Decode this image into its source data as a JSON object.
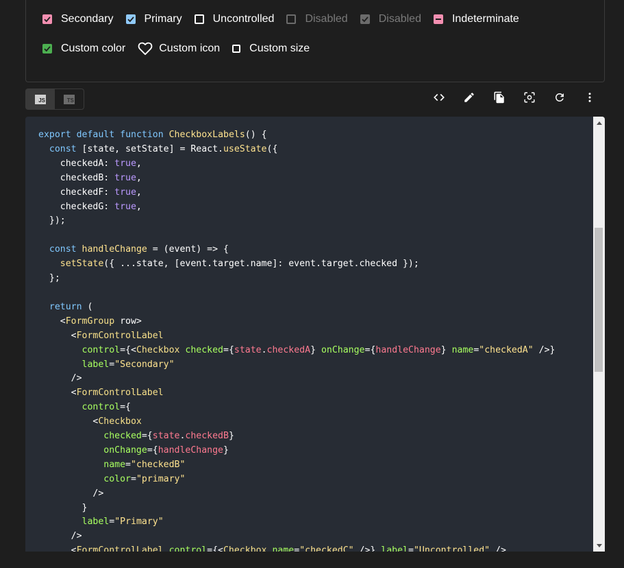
{
  "demo": {
    "row1": [
      {
        "label": "Secondary",
        "state": "checked",
        "color": "#f48fb1"
      },
      {
        "label": "Primary",
        "state": "checked",
        "color": "#90caf9"
      },
      {
        "label": "Uncontrolled",
        "state": "unchecked"
      },
      {
        "label": "Disabled",
        "state": "disabled-unchecked"
      },
      {
        "label": "Disabled",
        "state": "disabled-checked"
      },
      {
        "label": "Indeterminate",
        "state": "indeterminate",
        "color": "#f48fb1"
      }
    ],
    "row2": [
      {
        "label": "Custom color",
        "state": "checked",
        "color": "#4caf50"
      },
      {
        "label": "Custom icon",
        "icon": "heart-outline-icon"
      },
      {
        "label": "Custom size",
        "state": "unchecked-small"
      }
    ]
  },
  "toolbar": {
    "languages": [
      {
        "label": "JS",
        "active": true
      },
      {
        "label": "TS",
        "active": false
      }
    ],
    "actions": [
      "code-icon",
      "edit-icon",
      "copy-icon",
      "screenshot-icon",
      "reset-icon",
      "more-vert-icon"
    ]
  },
  "code": {
    "language": "javascript",
    "lines": [
      "export default function CheckboxLabels() {",
      "  const [state, setState] = React.useState({",
      "    checkedA: true,",
      "    checkedB: true,",
      "    checkedF: true,",
      "    checkedG: true,",
      "  });",
      "",
      "  const handleChange = (event) => {",
      "    setState({ ...state, [event.target.name]: event.target.checked });",
      "  };",
      "",
      "  return (",
      "    <FormGroup row>",
      "      <FormControlLabel",
      "        control={<Checkbox checked={state.checkedA} onChange={handleChange} name=\"checkedA\" />}",
      "        label=\"Secondary\"",
      "      />",
      "      <FormControlLabel",
      "        control={",
      "          <Checkbox",
      "            checked={state.checkedB}",
      "            onChange={handleChange}",
      "            name=\"checkedB\"",
      "            color=\"primary\"",
      "          />",
      "        }",
      "        label=\"Primary\"",
      "      />",
      "      <FormControlLabel control={<Checkbox name=\"checkedC\" />} label=\"Uncontrolled\" />"
    ]
  }
}
